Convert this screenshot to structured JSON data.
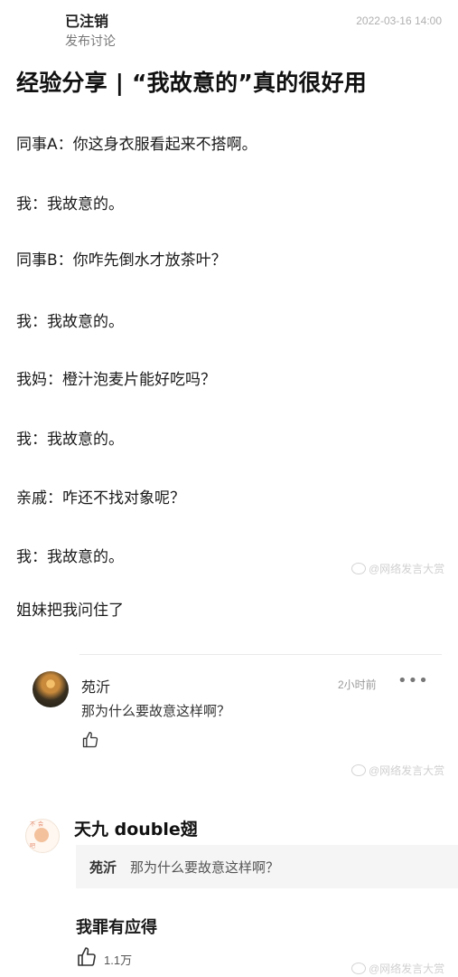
{
  "post": {
    "author_name": "已注销",
    "author_sub": "发布讨论",
    "date": "2022-03-16 14:00",
    "title": "经验分享 | “我故意的”真的很好用",
    "lines": [
      "同事A：你这身衣服看起来不搭啊。",
      "我：我故意的。",
      "同事B：你咋先倒水才放茶叶？",
      "我：我故意的。",
      "我妈：橙汁泡麦片能好吃吗？",
      "我：我故意的。",
      "亲戚：咋还不找对象呢？",
      "我：我故意的。",
      "姐妹把我问住了"
    ]
  },
  "watermark": "@网络发言大赏",
  "comments": [
    {
      "author": "苑沂",
      "time": "2小时前",
      "more_label": "•••",
      "text": "那为什么要故意这样啊？",
      "avatar_icon": "avatar-photo"
    },
    {
      "author": "天九 double翅",
      "quote_author": "苑沂",
      "quote_text": "那为什么要故意这样啊？",
      "text": "我罪有应得",
      "like_count": "1.1万",
      "avatar_icon": "avatar-cartoon"
    }
  ],
  "icons": {
    "like": "thumbs-up-icon",
    "weibo": "weibo-icon"
  },
  "colors": {
    "text_primary": "#1a1a1a",
    "text_secondary": "#777777",
    "watermark": "#d0d0d0",
    "quote_bg": "#f5f5f5"
  }
}
